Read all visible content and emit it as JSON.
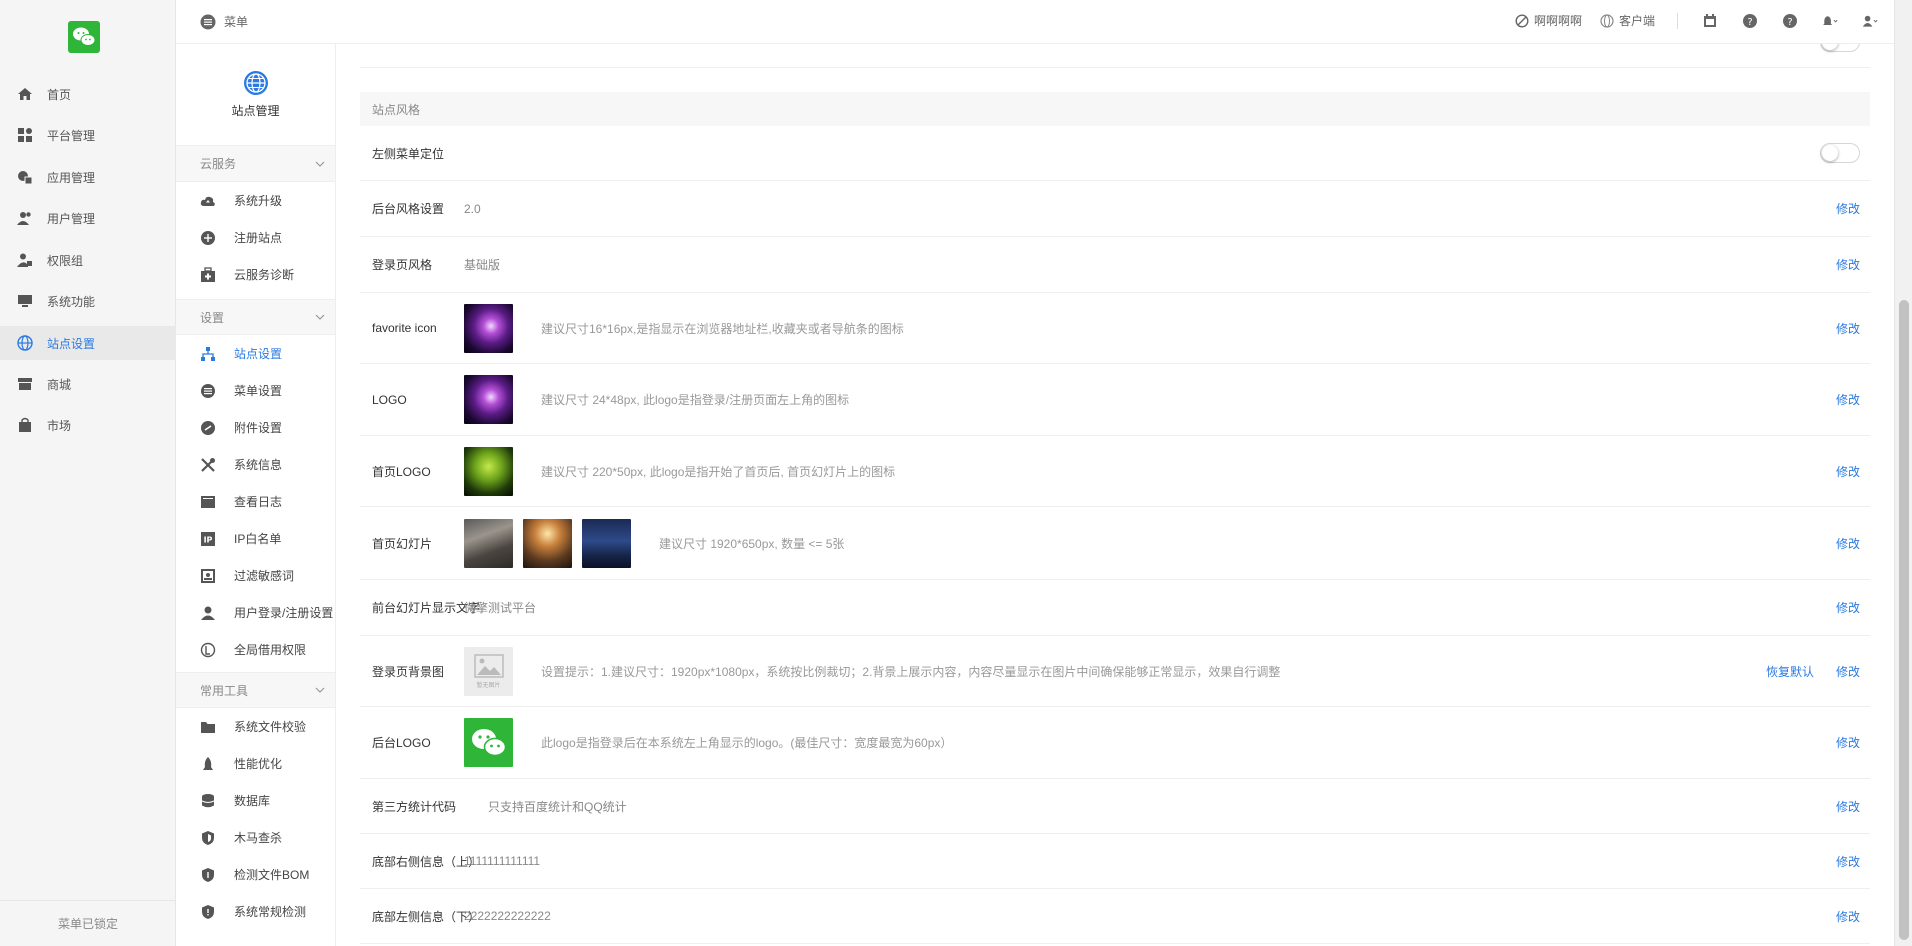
{
  "nav": {
    "items": [
      {
        "label": "首页",
        "icon": "home-icon"
      },
      {
        "label": "平台管理",
        "icon": "grid-icon"
      },
      {
        "label": "应用管理",
        "icon": "apps-icon"
      },
      {
        "label": "用户管理",
        "icon": "users-icon"
      },
      {
        "label": "权限组",
        "icon": "permission-icon"
      },
      {
        "label": "系统功能",
        "icon": "monitor-icon"
      },
      {
        "label": "站点设置",
        "icon": "globe-icon"
      },
      {
        "label": "商城",
        "icon": "store-icon"
      },
      {
        "label": "市场",
        "icon": "bag-icon"
      }
    ],
    "active_index": 6,
    "footer": "菜单已锁定"
  },
  "topbar": {
    "menu_label": "菜单",
    "link1": "啊啊啊啊",
    "link2": "客户端"
  },
  "sub": {
    "title": "站点管理",
    "groups": {
      "cloud": "云服务",
      "settings": "设置",
      "tools": "常用工具"
    },
    "cloud_items": [
      "系统升级",
      "注册站点",
      "云服务诊断"
    ],
    "settings_items": [
      "站点设置",
      "菜单设置",
      "附件设置",
      "系统信息",
      "查看日志",
      "IP白名单",
      "过滤敏感词",
      "用户登录/注册设置",
      "全局借用权限"
    ],
    "tool_items": [
      "系统文件校验",
      "性能优化",
      "数据库",
      "木马查杀",
      "检测文件BOM",
      "系统常规检测"
    ],
    "active_setting": "站点设置"
  },
  "main": {
    "section_title": "站点风格",
    "rows": {
      "left_menu": {
        "label": "左侧菜单定位",
        "enabled": false
      },
      "admin_style": {
        "label": "后台风格设置",
        "value": "2.0",
        "action": "修改"
      },
      "login_style": {
        "label": "登录页风格",
        "value": "基础版",
        "action": "修改"
      },
      "favicon": {
        "label": "favorite icon",
        "hint": "建议尺寸16*16px,是指显示在浏览器地址栏,收藏夹或者导航条的图标",
        "action": "修改"
      },
      "logo": {
        "label": "LOGO",
        "hint": "建议尺寸 24*48px, 此logo是指登录/注册页面左上角的图标",
        "action": "修改"
      },
      "home_logo": {
        "label": "首页LOGO",
        "hint": "建议尺寸 220*50px, 此logo是指开始了首页后, 首页幻灯片上的图标",
        "action": "修改"
      },
      "slides": {
        "label": "首页幻灯片",
        "hint": "建议尺寸 1920*650px, 数量 <= 5张",
        "action": "修改"
      },
      "slide_text": {
        "label": "前台幻灯片显示文字",
        "value": "微擎测试平台",
        "action": "修改"
      },
      "login_bg": {
        "label": "登录页背景图",
        "placeholder": "暂无图片",
        "hint": "设置提示：1.建议尺寸：1920px*1080px，系统按比例裁切；2.背景上展示内容，内容尽量显示在图片中间确保能够正常显示，效果自行调整",
        "action_restore": "恢复默认",
        "action": "修改"
      },
      "admin_logo": {
        "label": "后台LOGO",
        "hint": "此logo是指登录后在本系统左上角显示的logo。(最佳尺寸：宽度最宽为60px）",
        "action": "修改"
      },
      "stats_code": {
        "label": "第三方统计代码",
        "value": "只支持百度统计和QQ统计",
        "action": "修改"
      },
      "footer_right": {
        "label": "底部右侧信息（上）",
        "value": "1111111111111",
        "action": "修改"
      },
      "footer_left": {
        "label": "底部左侧信息（下）",
        "value": "2222222222222",
        "action": "修改"
      }
    }
  },
  "colors": {
    "accent": "#2a7ae2",
    "wechat": "#2fb537"
  }
}
